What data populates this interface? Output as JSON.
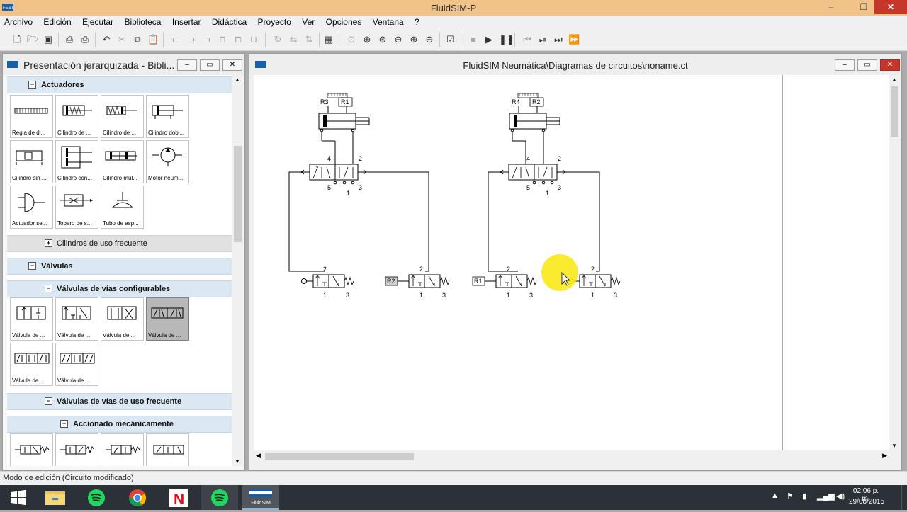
{
  "app": {
    "title": "FluidSIM-P",
    "window_buttons": {
      "minimize": "–",
      "maximize": "❐",
      "close": "✕"
    }
  },
  "menu": [
    "Archivo",
    "Edición",
    "Ejecutar",
    "Biblioteca",
    "Insertar",
    "Didáctica",
    "Proyecto",
    "Ver",
    "Opciones",
    "Ventana",
    "?"
  ],
  "toolbar": {
    "icons": [
      "new-icon",
      "open-icon",
      "save-icon",
      "print-preview-icon",
      "print-icon",
      "undo-icon",
      "cut-icon",
      "copy-icon",
      "paste-icon",
      "align-left-icon",
      "align-center-icon",
      "align-right-icon",
      "align-top-icon",
      "align-middle-icon",
      "align-bottom-icon",
      "rotate-icon",
      "flip-icon",
      "grid-icon",
      "zoom-fit-icon",
      "zoom-area-icon",
      "zoom-100-icon",
      "zoom-page-icon",
      "zoom-in-icon",
      "zoom-out-icon",
      "check-icon",
      "stop-icon",
      "play-icon",
      "pause-icon",
      "reset-icon",
      "step-icon",
      "step-end-icon",
      "fast-forward-icon"
    ]
  },
  "library": {
    "title": "Presentación jerarquizada - Bibli...",
    "sections": {
      "actuators": "Actuadores",
      "frequent_cylinders": "Cilindros de uso frecuente",
      "valves": "Válvulas",
      "configurable_valves": "Válvulas de vías configurables",
      "frequent_valves": "Válvulas de vías de uso frecuente",
      "mechanical": "Accionado mecánicamente"
    },
    "actuator_tiles": [
      "Regla de di...",
      "Cilindro de ...",
      "Cilindro de ...",
      "Cilindro dobl...",
      "Cilindro sin ...",
      "Cilindro con...",
      "Cilindro mul...",
      "Motor neum...",
      "Actuador se...",
      "Tobero de s...",
      "Tubo de asp..."
    ],
    "valve_tiles": [
      "Válvula de ...",
      "Válvula de ...",
      "Válvula de ...",
      "Válvula de ...",
      "Válvula de ...",
      "Válvula de ..."
    ],
    "selected_tile": "Válvula de ..."
  },
  "circuit": {
    "title": "FluidSIM Neumática\\Diagramas de circuitos\\noname.ct",
    "labels": {
      "r1": "R1",
      "r2": "R2",
      "r3": "R3",
      "r4": "R4",
      "port1": "1",
      "port2": "2",
      "port3": "3",
      "port4": "4",
      "port5": "5"
    }
  },
  "status": "Modo de edición (Circuito modificado)",
  "taskbar": {
    "apps": [
      "windows-start-icon",
      "file-explorer-icon",
      "spotify-icon",
      "chrome-icon",
      "netflix-icon",
      "spotify-icon",
      "fluidsim-icon"
    ],
    "fluidsim_label": "FluidSIM",
    "time": "02:06 p. m.",
    "date": "29/08/2015"
  }
}
